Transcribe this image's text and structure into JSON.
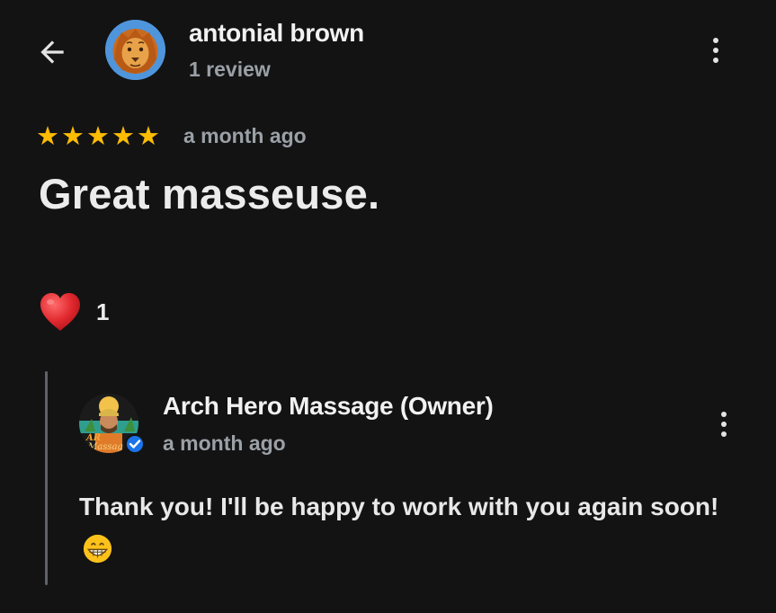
{
  "header": {
    "reviewer_name": "antonial brown",
    "review_count": "1 review"
  },
  "review": {
    "rating": 5,
    "rating_max": 5,
    "star_glyph": "★",
    "date": "a month ago",
    "text": "Great masseuse."
  },
  "reactions": {
    "like_icon": "heart-icon",
    "count": "1"
  },
  "reply": {
    "owner_name": "Arch Hero Massage (Owner)",
    "date": "a month ago",
    "text": "Thank you! I'll be happy to work with you again soon!",
    "emoji_icon": "grinning-face-emoji",
    "avatar_logo": "Arch Hero Massage"
  },
  "colors": {
    "background": "#131314",
    "star": "#fbbc04",
    "secondary_text": "#9aa0a6",
    "verified_badge": "#1a73e8",
    "heart": "#e0282e"
  }
}
